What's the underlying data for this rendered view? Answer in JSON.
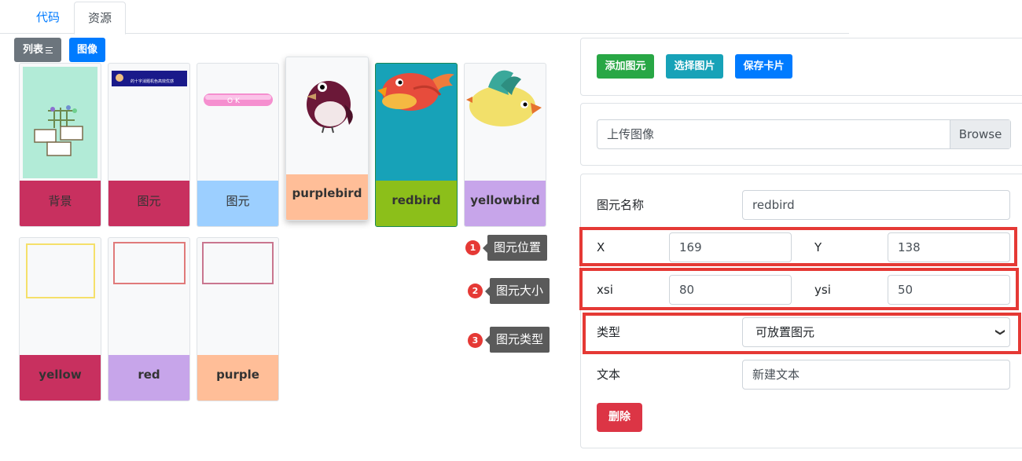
{
  "tabs": [
    {
      "label": "代码"
    },
    {
      "label": "资源"
    }
  ],
  "view_buttons": {
    "list": "列表",
    "image": "图像"
  },
  "assets": [
    {
      "label": "背景",
      "color": "#c8305f"
    },
    {
      "label": "图元",
      "color": "#c8305f",
      "thumb_text": "的十字消题机色高效优感"
    },
    {
      "label": "图元",
      "color": "#9ccfff",
      "thumb_text": "O K"
    },
    {
      "label": "purplebird",
      "color": "#ffbe98"
    },
    {
      "label": "redbird",
      "color": "#8cbf1a"
    },
    {
      "label": "yellowbird",
      "color": "#c7a5ea"
    },
    {
      "label": "yellow",
      "color": "#c8305f"
    },
    {
      "label": "red",
      "color": "#c7a5ea"
    },
    {
      "label": "purple",
      "color": "#ffbe98"
    }
  ],
  "annotations": [
    {
      "num": "1",
      "text": "图元位置"
    },
    {
      "num": "2",
      "text": "图元大小"
    },
    {
      "num": "3",
      "text": "图元类型"
    }
  ],
  "actions": {
    "add": "添加图元",
    "select": "选择图片",
    "save": "保存卡片"
  },
  "upload": {
    "text": "上传图像",
    "browse": "Browse"
  },
  "form": {
    "name_label": "图元名称",
    "name_value": "redbird",
    "x_label": "X",
    "x_value": "169",
    "y_label": "Y",
    "y_value": "138",
    "xsi_label": "xsi",
    "xsi_value": "80",
    "ysi_label": "ysi",
    "ysi_value": "50",
    "type_label": "类型",
    "type_value": "可放置图元",
    "text_label": "文本",
    "text_value": "新建文本",
    "delete": "删除"
  }
}
